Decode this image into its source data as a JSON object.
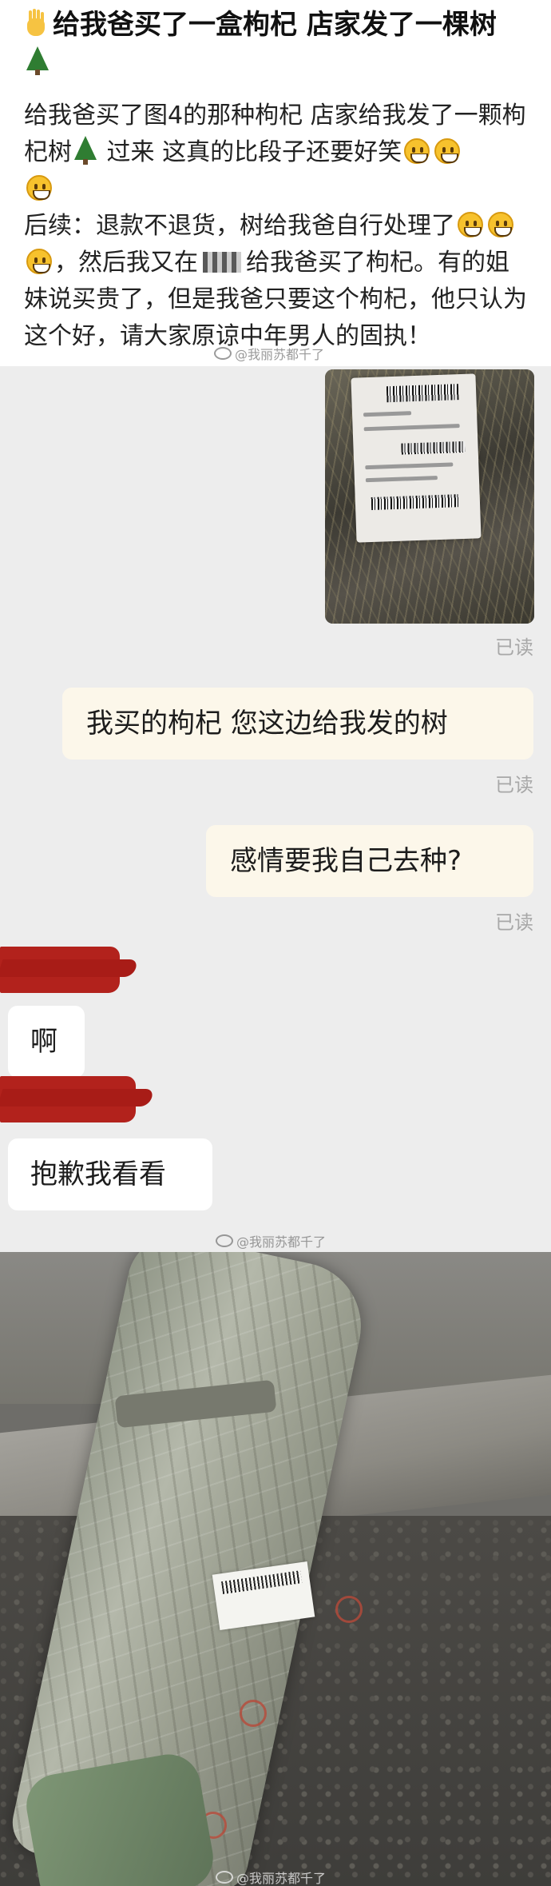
{
  "post": {
    "title": "给我爸买了一盒枸杞 店家发了一棵树",
    "body": {
      "p1_a": "给我爸买了图4的那种枸杞 店家给我发了一颗枸杞树",
      "p1_b": " 过来 这真的比段子还要好笑",
      "p2_a": "后续：退款不退货，树给我爸自行处理了",
      "p2_b": "，然后我又在",
      "p2_c": "给我爸买了枸杞。有的姐妹说买贵了，但是我爸只要这个枸杞，他只认为这个好，请大家原谅中年男人的固执！"
    }
  },
  "watermarks": {
    "top": "@我丽苏都千了",
    "middle": "@我丽苏都千了",
    "bottom": "@我丽苏都千了"
  },
  "chat": {
    "messages": [
      {
        "side": "right",
        "type": "image",
        "read_status": "已读"
      },
      {
        "side": "right",
        "type": "text",
        "text": "我买的枸杞 您这边给我发的树",
        "read_status": "已读"
      },
      {
        "side": "right",
        "type": "text",
        "text": "感情要我自己去种?",
        "read_status": "已读"
      },
      {
        "side": "left",
        "type": "text",
        "text": "啊"
      },
      {
        "side": "left",
        "type": "text",
        "text": "抱歉我看看"
      }
    ]
  },
  "colors": {
    "chat_background": "#ededed",
    "bubble_right": "#fcf7ea",
    "bubble_left": "#ffffff",
    "read_text": "#a8a8a8",
    "redaction": "#b2221c"
  },
  "icons": [
    "raised-hand-icon",
    "evergreen-tree-icon",
    "grinning-face-icon",
    "weibo-logo-icon"
  ]
}
